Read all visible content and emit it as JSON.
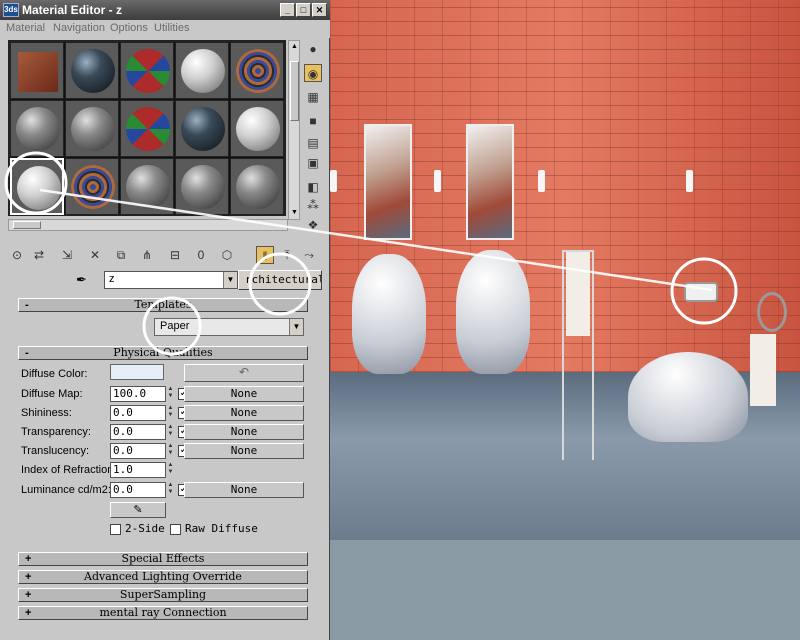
{
  "window": {
    "title": "Material Editor - z",
    "app_icon_text": "3ds",
    "buttons": [
      "_",
      "□",
      "✕"
    ]
  },
  "menu": [
    "Material",
    "Navigation",
    "Options",
    "Utilities"
  ],
  "material_name": "z",
  "material_type": "rchitectural",
  "templates": {
    "header": "Templates",
    "sign": "-",
    "value": "Paper"
  },
  "physical_qualities": {
    "header": "Physical Qualities",
    "sign": "-",
    "diffuse_color_label": "Diffuse Color:",
    "diffuse_map_label": "Diffuse Map:",
    "diffuse_map_value": "100.0",
    "shininess_label": "Shininess:",
    "shininess_value": "0.0",
    "transparency_label": "Transparency:",
    "transparency_value": "0.0",
    "translucency_label": "Translucency:",
    "translucency_value": "0.0",
    "ior_label": "Index of Refraction:",
    "ior_value": "1.0",
    "luminance_label": "Luminance cd/m2:",
    "luminance_value": "0.0",
    "map_none": "None",
    "check": "✓",
    "two_side": "2-Side",
    "raw_diffuse": "Raw Diffuse",
    "undo_glyph": "↶",
    "paint_glyph": "✎"
  },
  "rollouts": [
    {
      "sign": "+",
      "label": "Special Effects"
    },
    {
      "sign": "+",
      "label": "Advanced Lighting Override"
    },
    {
      "sign": "+",
      "label": "SuperSampling"
    },
    {
      "sign": "+",
      "label": "mental ray Connection"
    }
  ],
  "icons": {
    "side_toolbar": [
      "sample-type-sphere-icon",
      "backlight-icon",
      "background-checker-icon",
      "sample-uv-tiling-icon",
      "video-color-check-icon",
      "make-preview-icon",
      "options-icon",
      "select-by-material-icon",
      "material-navigator-icon"
    ],
    "bottom_toolbar": [
      "get-material-icon",
      "put-to-scene-icon",
      "assign-to-selection-icon",
      "reset-map-icon",
      "make-copy-icon",
      "make-unique-icon",
      "put-to-library-icon",
      "material-id-channel-icon",
      "show-map-icon",
      "show-end-result-icon",
      "go-to-parent-icon",
      "go-forward-icon"
    ]
  },
  "colors": {
    "diffuse": "#e6eef8",
    "active_toolbar": "#e8c060"
  }
}
